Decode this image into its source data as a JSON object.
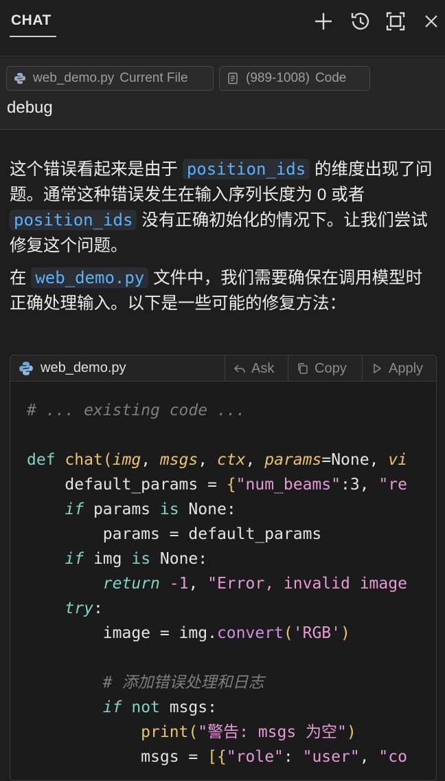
{
  "header": {
    "tab_label": "CHAT",
    "icons": [
      "plus-icon",
      "history-icon",
      "maximize-icon",
      "close-icon"
    ]
  },
  "context": {
    "file_pill": {
      "name": "web_demo.py",
      "sub": "Current File"
    },
    "code_pill": {
      "range": "(989-1008)",
      "sub": "Code"
    },
    "prompt": "debug"
  },
  "answer": {
    "p1_a": "这个错误看起来是由于 ",
    "p1_code1": "position_ids",
    "p1_b": " 的维度出现了问题。通常这种错误发生在输入序列长度为 0 或者 ",
    "p1_code2": "position_ids",
    "p1_c": " 没有正确初始化的情况下。让我们尝试修复这个问题。",
    "p2_a": "在 ",
    "p2_code": "web_demo.py",
    "p2_b": " 文件中，我们需要确保在调用模型时正确处理输入。以下是一些可能的修复方法："
  },
  "codeblock": {
    "filename": "web_demo.py",
    "ask_label": "Ask",
    "copy_label": "Copy",
    "apply_label": "Apply"
  },
  "colors": {
    "background": "#1e1e1e",
    "inline_code": "#5ab2f7",
    "keyword": "#7fd3c8",
    "function": "#e9c46a",
    "string": "#e59ad6",
    "comment": "#7d7d7d"
  }
}
